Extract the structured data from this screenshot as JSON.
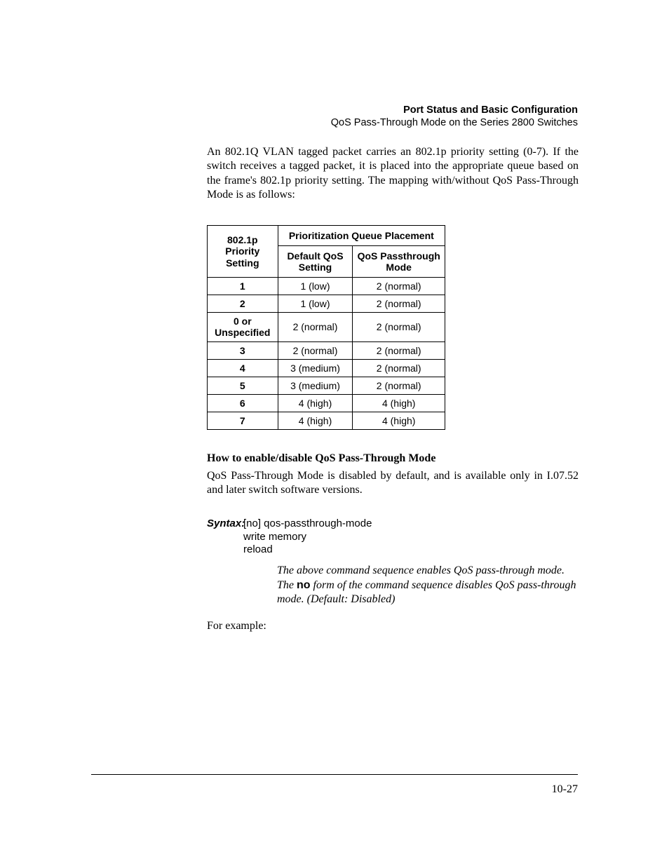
{
  "header": {
    "title": "Port Status and Basic Configuration",
    "subtitle": "QoS Pass-Through Mode on the Series 2800 Switches"
  },
  "intro": "An 802.1Q VLAN tagged packet carries an 802.1p priority setting (0-7). If the switch receives a tagged packet, it is placed into the appropriate queue based on the frame's 802.1p priority setting. The mapping with/without QoS Pass-Through Mode is as follows:",
  "table": {
    "col_priority": "802.1p Priority Setting",
    "col_span": "Prioritization Queue Placement",
    "col_default": "Default QoS Setting",
    "col_passthrough": "QoS Passthrough Mode",
    "rows": [
      {
        "p": "1",
        "def": "1 (low)",
        "pass": "2 (normal)"
      },
      {
        "p": "2",
        "def": "1 (low)",
        "pass": "2 (normal)"
      },
      {
        "p": "0 or Unspecified",
        "def": "2 (normal)",
        "pass": "2 (normal)"
      },
      {
        "p": "3",
        "def": "2 (normal)",
        "pass": "2 (normal)"
      },
      {
        "p": "4",
        "def": "3 (medium)",
        "pass": "2 (normal)"
      },
      {
        "p": "5",
        "def": "3 (medium)",
        "pass": "2 (normal)"
      },
      {
        "p": "6",
        "def": "4 (high)",
        "pass": "4 (high)"
      },
      {
        "p": "7",
        "def": "4 (high)",
        "pass": "4 (high)"
      }
    ]
  },
  "section2": {
    "heading": "How to enable/disable QoS Pass-Through Mode",
    "body": "QoS Pass-Through Mode is disabled by default, and is available only in I.07.52 and later switch software versions."
  },
  "syntax": {
    "label": "Syntax:",
    "cmd1": "[no] qos-passthrough-mode",
    "cmd2": "write memory",
    "cmd3": "reload",
    "desc_pre": "The above command sequence enables QoS pass-through mode. The ",
    "desc_no": "no",
    "desc_post": " form of the command sequence disables QoS pass-through mode. (Default: Disabled)"
  },
  "example_lead": "For example:",
  "page_number": "10-27"
}
